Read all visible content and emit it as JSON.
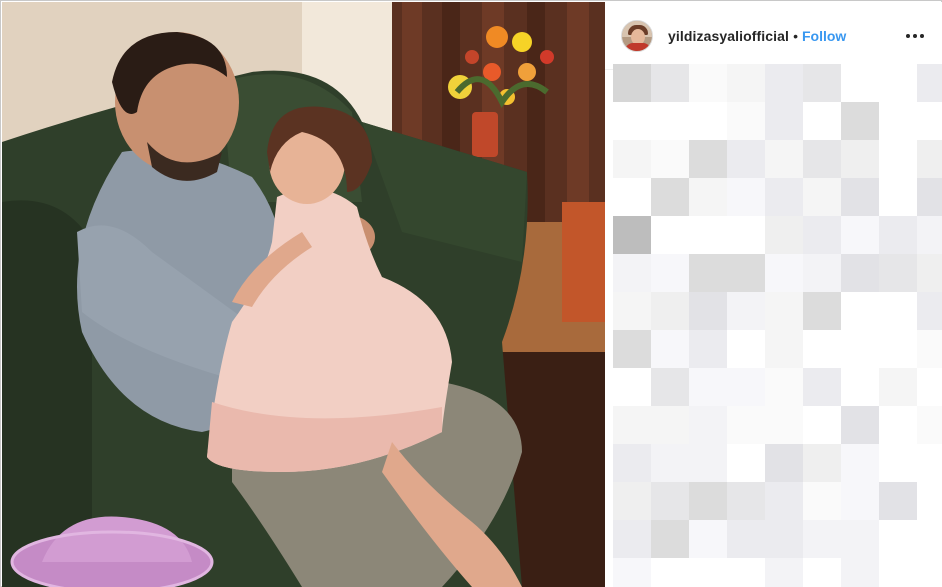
{
  "post": {
    "username": "yildizasyaliofficial",
    "separator": "•",
    "follow_label": "Follow",
    "more_icon": "ellipsis-horizontal-icon"
  },
  "photo": {
    "description_colors": {
      "sofa": "#2f3f2a",
      "wall": "#e9dccb",
      "shirt": "#8f9aa6",
      "dress": "#f2cfc4",
      "curtain": "#5a3020",
      "hat": "#c58bc6"
    }
  },
  "colors": {
    "accent": "#3897f0",
    "text": "#262626",
    "divider": "#efefef"
  },
  "comments_pixelated": true
}
